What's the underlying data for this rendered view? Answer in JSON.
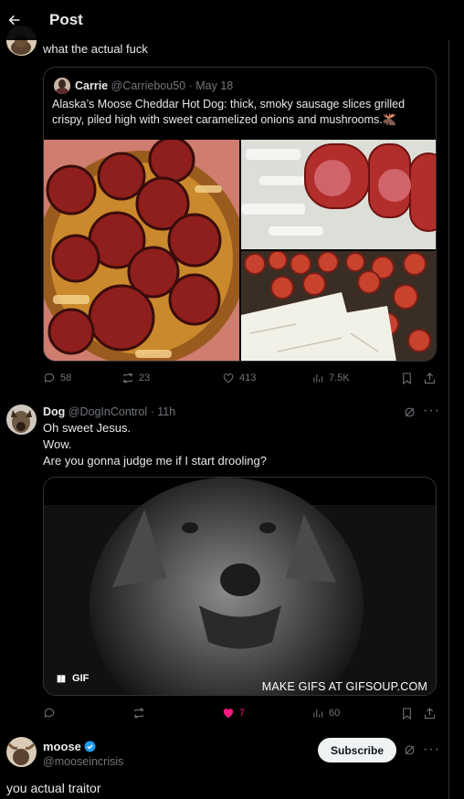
{
  "header": {
    "title": "Post"
  },
  "reply1": {
    "text": "what the actual fuck"
  },
  "quote": {
    "author": "Carrie",
    "handle": "@Carriebou50",
    "date": "May 18",
    "text": "Alaska’s Moose Cheddar Hot Dog: thick, smoky sausage slices grilled crispy, piled high with sweet caramelized onions and mushrooms.🫎"
  },
  "stats1": {
    "replies": "58",
    "reposts": "23",
    "likes": "413",
    "views": "7.5K"
  },
  "dog_post": {
    "author": "Dog",
    "handle": "@DogInControl",
    "time": "11h",
    "lines": [
      "Oh sweet Jesus.",
      "Wow.",
      "Are you gonna judge me if I start drooling?"
    ],
    "gif_badge": "GIF",
    "gif_caption": "MAKE GIFS AT GIFSOUP.COM"
  },
  "stats2": {
    "replies": "",
    "reposts": "",
    "likes": "7",
    "views": "60",
    "like_color": "#f91880"
  },
  "moose": {
    "name": "moose",
    "handle": "@mooseincrisis",
    "subscribe_label": "Subscribe",
    "verified_color": "#1d9bf0",
    "reply_text": "you actual traitor"
  },
  "icons": [
    "back-arrow-icon",
    "reply-icon",
    "repost-icon",
    "like-icon",
    "views-icon",
    "bookmark-icon",
    "share-icon",
    "grok-icon",
    "more-icon",
    "pause-icon",
    "verified-icon"
  ]
}
